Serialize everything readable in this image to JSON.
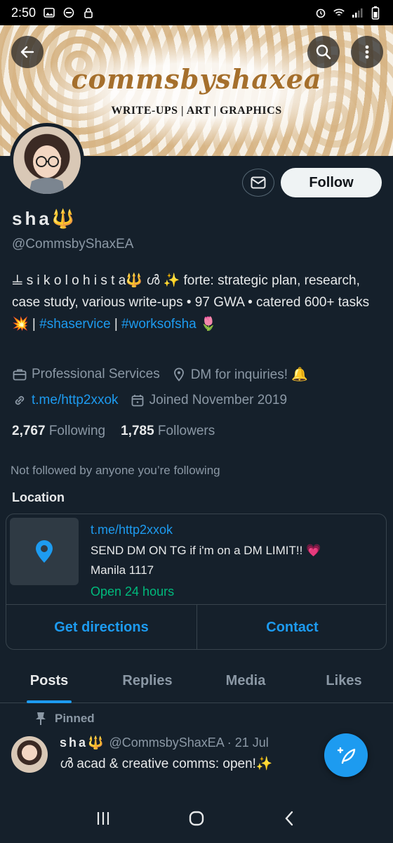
{
  "status_bar": {
    "time": "2:50",
    "icons_left": [
      "image-icon",
      "do-not-disturb-icon",
      "lock-icon"
    ],
    "icons_right": [
      "alarm-icon",
      "wifi-icon",
      "signal-icon",
      "battery-icon"
    ]
  },
  "banner": {
    "title": "commsbyshaxea",
    "subtitle": "WRITE-UPS | ART | GRAPHICS",
    "colors": {
      "accent": "#a56f2c",
      "stripe": "#d9b98c"
    }
  },
  "profile": {
    "display_name": "sha🔱",
    "handle": "@CommsbyShaxEA",
    "follow_label": "Follow",
    "bio_part1": "𝍦 s i k o l o h i s t a🔱 ൾ ✨ forte: strategic plan, research, case study, various write-ups • 97 GWA • catered 600+ tasks 💥 | ",
    "bio_tag1": "#shaservice",
    "bio_sep": "  | ",
    "bio_tag2": "#worksofsha",
    "bio_end": " 🌷",
    "category": "Professional Services",
    "location": "DM for inquiries! 🔔",
    "link": "t.me/http2xxok",
    "joined": "Joined November 2019",
    "following_count": "2,767",
    "following_label": "Following",
    "followers_count": "1,785",
    "followers_label": "Followers",
    "not_followed": "Not followed by anyone you’re following"
  },
  "location_card": {
    "heading": "Location",
    "link": "t.me/http2xxok",
    "description": "SEND DM ON TG if i'm on a DM LIMIT!! 💗",
    "address": "Manila  1117",
    "hours": "Open 24 hours",
    "directions_label": "Get directions",
    "contact_label": "Contact"
  },
  "tabs": [
    {
      "label": "Posts",
      "active": true
    },
    {
      "label": "Replies",
      "active": false
    },
    {
      "label": "Media",
      "active": false
    },
    {
      "label": "Likes",
      "active": false
    }
  ],
  "pinned_post": {
    "pinned_label": "Pinned",
    "author": "sha🔱",
    "meta": " @CommsbyShaxEA · 21 Jul",
    "text": "ൾ acad & creative comms: open!✨"
  },
  "colors": {
    "background": "#15202b",
    "link": "#1d9bf0",
    "open": "#00ba7c",
    "muted": "#8b98a5"
  }
}
